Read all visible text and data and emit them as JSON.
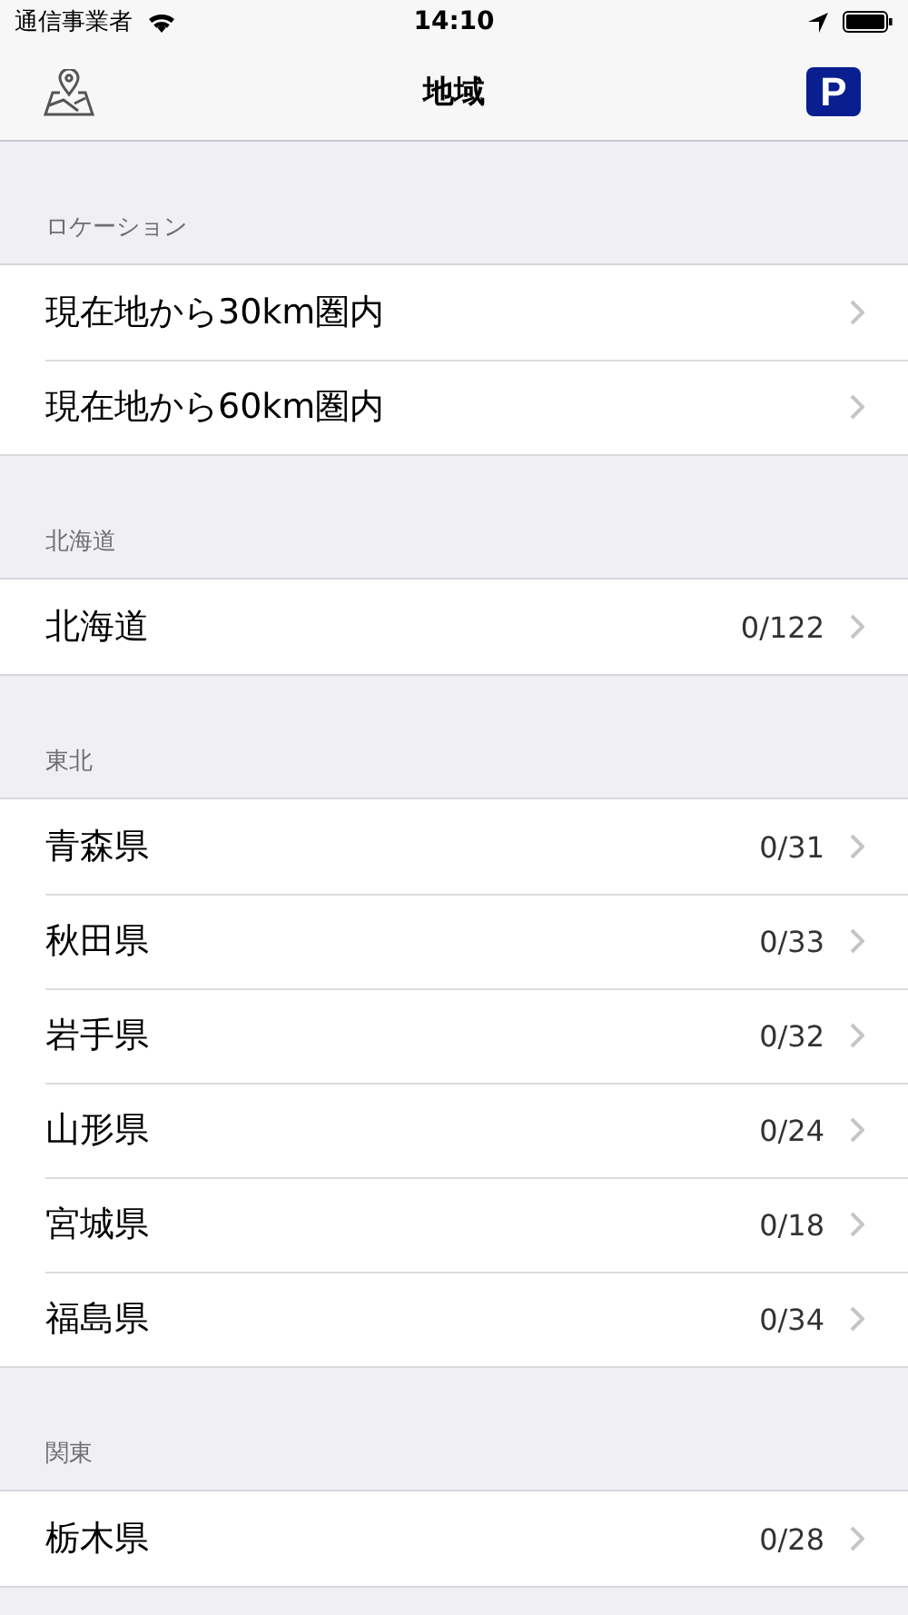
{
  "status_bar": {
    "carrier": "通信事業者",
    "time": "14:10"
  },
  "nav": {
    "title": "地域",
    "right_button": "P"
  },
  "sections": [
    {
      "header": "ロケーション",
      "rows": [
        {
          "label": "現在地から30km圏内"
        },
        {
          "label": "現在地から60km圏内"
        }
      ]
    },
    {
      "header": "北海道",
      "rows": [
        {
          "label": "北海道",
          "count": "0/122"
        }
      ]
    },
    {
      "header": "東北",
      "rows": [
        {
          "label": "青森県",
          "count": "0/31"
        },
        {
          "label": "秋田県",
          "count": "0/33"
        },
        {
          "label": "岩手県",
          "count": "0/32"
        },
        {
          "label": "山形県",
          "count": "0/24"
        },
        {
          "label": "宮城県",
          "count": "0/18"
        },
        {
          "label": "福島県",
          "count": "0/34"
        }
      ]
    },
    {
      "header": "関東",
      "rows": [
        {
          "label": "栃木県",
          "count": "0/28"
        }
      ]
    }
  ]
}
